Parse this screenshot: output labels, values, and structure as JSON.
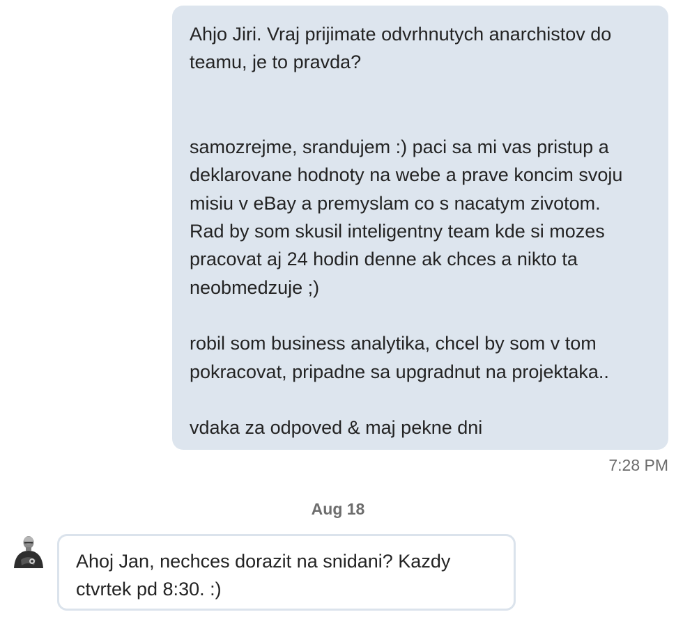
{
  "conversation": {
    "outgoing_message": {
      "paragraphs": [
        "Ahjo Jiri. Vraj prijimate odvrhnutych anarchistov do\nteamu, je to pravda?",
        "samozrejme, srandujem :) paci sa mi vas pristup a\ndeklarovane hodnoty na webe a prave koncim svoju\nmisiu v eBay a premyslam co s nacatym zivotom.\nRad by som skusil inteligentny team kde si mozes\npracovat aj 24 hodin denne ak chces a nikto ta\nneobmedzuje ;)",
        "robil som business analytika, chcel by som v tom\npokracovat, pripadne sa upgradnut na projektaka..",
        "vdaka za odpoved & maj pekne dni"
      ],
      "time": "7:28 PM"
    },
    "date_separator": "Aug 18",
    "incoming_message": {
      "avatar_icon": "user-avatar-photo",
      "text": "Ahoj Jan, nechces dorazit na snidani? Kazdy\nctvrtek pd 8:30. :)"
    }
  },
  "colors": {
    "outgoing_bubble": "#dde5ee",
    "incoming_bubble_border": "#dbe3ec",
    "text": "#232323",
    "meta_text": "#6b6b6b"
  }
}
